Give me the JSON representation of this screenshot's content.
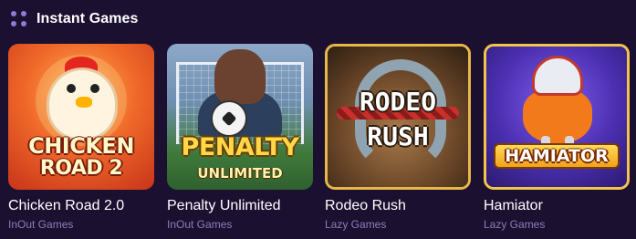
{
  "section": {
    "title": "Instant Games",
    "icon": "grid-dots-icon",
    "accent": "#8f7bd6"
  },
  "games": [
    {
      "name": "Chicken Road 2.0",
      "provider": "InOut Games",
      "art_text_line1": "CHICKEN",
      "art_text_line2": "ROAD 2"
    },
    {
      "name": "Penalty Unlimited",
      "provider": "InOut Games",
      "art_text_line1": "PENALTY",
      "art_text_line2": "UNLIMITED"
    },
    {
      "name": "Rodeo Rush",
      "provider": "Lazy Games",
      "art_text_line1": "RODEO",
      "art_text_line2": "RUSH"
    },
    {
      "name": "Hamiator",
      "provider": "Lazy Games",
      "art_text_line1": "HAMIATOR"
    }
  ]
}
